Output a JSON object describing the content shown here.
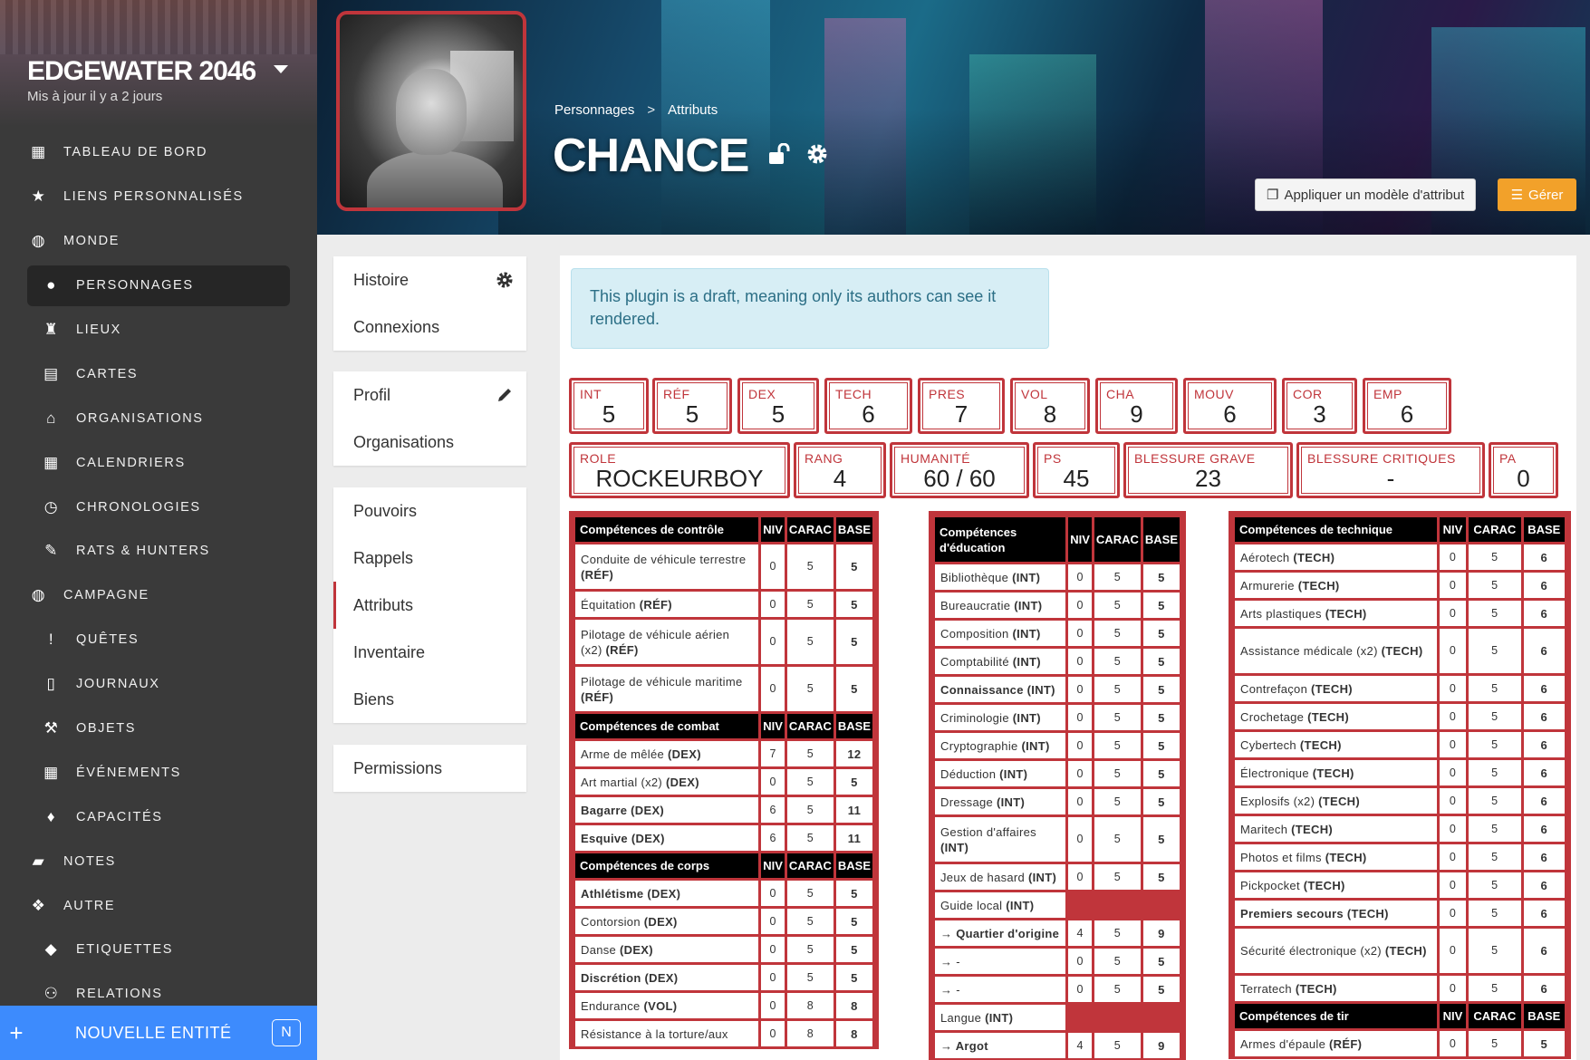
{
  "sidebar": {
    "campaign_name": "EDGEWATER 2046",
    "campaign_updated": "Mis à jour il y a 2 jours",
    "items": [
      {
        "label": "TABLEAU DE BORD",
        "icon": "dashboard-icon",
        "glyph": "▦",
        "level": 0
      },
      {
        "label": "LIENS PERSONNALISÉS",
        "icon": "star-icon",
        "glyph": "★",
        "level": 0
      },
      {
        "label": "MONDE",
        "icon": "globe-icon",
        "glyph": "◍",
        "level": 0
      },
      {
        "label": "PERSONNAGES",
        "icon": "user-icon",
        "glyph": "●",
        "level": 1,
        "active": true
      },
      {
        "label": "LIEUX",
        "icon": "chess-rook-icon",
        "glyph": "♜",
        "level": 1
      },
      {
        "label": "CARTES",
        "icon": "map-icon",
        "glyph": "▤",
        "level": 1
      },
      {
        "label": "ORGANISATIONS",
        "icon": "university-icon",
        "glyph": "⌂",
        "level": 1
      },
      {
        "label": "CALENDRIERS",
        "icon": "calendar-icon",
        "glyph": "▦",
        "level": 1
      },
      {
        "label": "CHRONOLOGIES",
        "icon": "clock-icon",
        "glyph": "◷",
        "level": 1
      },
      {
        "label": "RATS & HUNTERS",
        "icon": "feather-icon",
        "glyph": "✎",
        "level": 1
      },
      {
        "label": "CAMPAGNE",
        "icon": "globe-icon",
        "glyph": "◍",
        "level": 0
      },
      {
        "label": "QUÊTES",
        "icon": "exclamation-icon",
        "glyph": "!",
        "level": 1
      },
      {
        "label": "JOURNAUX",
        "icon": "file-icon",
        "glyph": "▯",
        "level": 1
      },
      {
        "label": "OBJETS",
        "icon": "objects-icon",
        "glyph": "⚒",
        "level": 1
      },
      {
        "label": "ÉVÉNEMENTS",
        "icon": "calendar-icon",
        "glyph": "▦",
        "level": 1
      },
      {
        "label": "CAPACITÉS",
        "icon": "fire-icon",
        "glyph": "♦",
        "level": 1
      },
      {
        "label": "NOTES",
        "icon": "sticky-note-icon",
        "glyph": "▰",
        "level": 0
      },
      {
        "label": "AUTRE",
        "icon": "cubes-icon",
        "glyph": "❖",
        "level": 0
      },
      {
        "label": "ETIQUETTES",
        "icon": "tags-icon",
        "glyph": "◆",
        "level": 1
      },
      {
        "label": "RELATIONS",
        "icon": "people-icon",
        "glyph": "⚇",
        "level": 1
      }
    ],
    "new_entity_label": "NOUVELLE ENTITÉ",
    "new_entity_shortcut": "N"
  },
  "header": {
    "breadcrumb": [
      "Personnages",
      "Attributs"
    ],
    "breadcrumb_sep": ">",
    "character_name": "CHANCE",
    "apply_template_label": "Appliquer un modèle d'attribut",
    "manage_label": "Gérer"
  },
  "menu": {
    "group1": [
      {
        "label": "Histoire",
        "action": "gear-icon"
      },
      {
        "label": "Connexions"
      }
    ],
    "group2": [
      {
        "label": "Profil",
        "action": "pencil-icon"
      },
      {
        "label": "Organisations"
      }
    ],
    "group3": [
      {
        "label": "Pouvoirs"
      },
      {
        "label": "Rappels"
      },
      {
        "label": "Attributs",
        "active": true
      },
      {
        "label": "Inventaire"
      },
      {
        "label": "Biens"
      }
    ],
    "group4": [
      {
        "label": "Permissions"
      }
    ]
  },
  "alert": "This plugin is a draft, meaning only its authors can see it rendered.",
  "stats_row1": [
    {
      "label": "INT",
      "value": "5"
    },
    {
      "label": "RÉF",
      "value": "5"
    },
    {
      "label": "DEX",
      "value": "5"
    },
    {
      "label": "TECH",
      "value": "6"
    },
    {
      "label": "PRES",
      "value": "7"
    },
    {
      "label": "VOL",
      "value": "8"
    },
    {
      "label": "CHA",
      "value": "9"
    },
    {
      "label": "MOUV",
      "value": "6"
    },
    {
      "label": "COR",
      "value": "3"
    },
    {
      "label": "EMP",
      "value": "6"
    }
  ],
  "stats_row2": [
    {
      "label": "ROLE",
      "value": "ROCKEURBOY"
    },
    {
      "label": "RANG",
      "value": "4"
    },
    {
      "label": "HUMANITÉ",
      "value": "60 / 60"
    },
    {
      "label": "PS",
      "value": "45"
    },
    {
      "label": "BLESSURE GRAVE",
      "value": "23"
    },
    {
      "label": "BLESSURE CRITIQUES",
      "value": "-"
    },
    {
      "label": "PA",
      "value": "0"
    }
  ],
  "columns_header": {
    "niv": "NIV",
    "carac": "CARAC",
    "base": "BASE"
  },
  "col1": [
    {
      "title": "Compétences de contrôle"
    },
    {
      "name": "Conduite de véhicule terrestre",
      "attr": "(RÉF)",
      "niv": "0",
      "carac": "5",
      "base": "5",
      "tall": true
    },
    {
      "name": "Équitation",
      "attr": "(RÉF)",
      "niv": "0",
      "carac": "5",
      "base": "5"
    },
    {
      "name": "Pilotage de véhicule aérien (x2)",
      "attr": "(RÉF)",
      "niv": "0",
      "carac": "5",
      "base": "5",
      "tall": true
    },
    {
      "name": "Pilotage de véhicule maritime",
      "attr": "(RÉF)",
      "niv": "0",
      "carac": "5",
      "base": "5",
      "tall": true
    },
    {
      "title": "Compétences de combat"
    },
    {
      "name": "Arme de mêlée",
      "attr": "(DEX)",
      "niv": "7",
      "carac": "5",
      "base": "12"
    },
    {
      "name": "Art martial (x2)",
      "attr": "(DEX)",
      "niv": "0",
      "carac": "5",
      "base": "5"
    },
    {
      "name": "Bagarre",
      "attr": "(DEX)",
      "niv": "6",
      "carac": "5",
      "base": "11",
      "bold": true
    },
    {
      "name": "Esquive",
      "attr": "(DEX)",
      "niv": "6",
      "carac": "5",
      "base": "11",
      "bold": true
    },
    {
      "title": "Compétences de corps"
    },
    {
      "name": "Athlétisme",
      "attr": "(DEX)",
      "niv": "0",
      "carac": "5",
      "base": "5",
      "bold": true
    },
    {
      "name": "Contorsion",
      "attr": "(DEX)",
      "niv": "0",
      "carac": "5",
      "base": "5"
    },
    {
      "name": "Danse",
      "attr": "(DEX)",
      "niv": "0",
      "carac": "5",
      "base": "5"
    },
    {
      "name": "Discrétion",
      "attr": "(DEX)",
      "niv": "0",
      "carac": "5",
      "base": "5",
      "bold": true
    },
    {
      "name": "Endurance",
      "attr": "(VOL)",
      "niv": "0",
      "carac": "8",
      "base": "8"
    },
    {
      "name": "Résistance à la torture/aux",
      "attr": "",
      "niv": "0",
      "carac": "8",
      "base": "8"
    }
  ],
  "col2": [
    {
      "title": "Compétences d'éducation",
      "tall": true
    },
    {
      "name": "Bibliothèque",
      "attr": "(INT)",
      "niv": "0",
      "carac": "5",
      "base": "5"
    },
    {
      "name": "Bureaucratie",
      "attr": "(INT)",
      "niv": "0",
      "carac": "5",
      "base": "5"
    },
    {
      "name": "Composition",
      "attr": "(INT)",
      "niv": "0",
      "carac": "5",
      "base": "5"
    },
    {
      "name": "Comptabilité",
      "attr": "(INT)",
      "niv": "0",
      "carac": "5",
      "base": "5"
    },
    {
      "name": "Connaissance",
      "attr": "(INT)",
      "niv": "0",
      "carac": "5",
      "base": "5",
      "bold": true
    },
    {
      "name": "Criminologie",
      "attr": "(INT)",
      "niv": "0",
      "carac": "5",
      "base": "5"
    },
    {
      "name": "Cryptographie",
      "attr": "(INT)",
      "niv": "0",
      "carac": "5",
      "base": "5"
    },
    {
      "name": "Déduction",
      "attr": "(INT)",
      "niv": "0",
      "carac": "5",
      "base": "5"
    },
    {
      "name": "Dressage",
      "attr": "(INT)",
      "niv": "0",
      "carac": "5",
      "base": "5"
    },
    {
      "name": "Gestion d'affaires",
      "attr": "(INT)",
      "niv": "0",
      "carac": "5",
      "base": "5",
      "tall": true
    },
    {
      "name": "Jeux de hasard",
      "attr": "(INT)",
      "niv": "0",
      "carac": "5",
      "base": "5"
    },
    {
      "name": "Guide local",
      "attr": "(INT)",
      "group": true
    },
    {
      "name": "→ Quartier d'origine",
      "attr": "",
      "niv": "4",
      "carac": "5",
      "base": "9",
      "bold": true
    },
    {
      "name": "→ -",
      "attr": "",
      "niv": "0",
      "carac": "5",
      "base": "5"
    },
    {
      "name": "→ -",
      "attr": "",
      "niv": "0",
      "carac": "5",
      "base": "5"
    },
    {
      "name": "Langue",
      "attr": "(INT)",
      "group": true
    },
    {
      "name": "→ Argot",
      "attr": "",
      "niv": "4",
      "carac": "5",
      "base": "9",
      "bold": true
    }
  ],
  "col3": [
    {
      "title": "Compétences de technique"
    },
    {
      "name": "Aérotech",
      "attr": "(TECH)",
      "niv": "0",
      "carac": "5",
      "base": "6"
    },
    {
      "name": "Armurerie",
      "attr": "(TECH)",
      "niv": "0",
      "carac": "5",
      "base": "6"
    },
    {
      "name": "Arts plastiques",
      "attr": "(TECH)",
      "niv": "0",
      "carac": "5",
      "base": "6"
    },
    {
      "name": "Assistance médicale (x2)",
      "attr": "(TECH)",
      "niv": "0",
      "carac": "5",
      "base": "6",
      "tall": true
    },
    {
      "name": "Contrefaçon",
      "attr": "(TECH)",
      "niv": "0",
      "carac": "5",
      "base": "6"
    },
    {
      "name": "Crochetage",
      "attr": "(TECH)",
      "niv": "0",
      "carac": "5",
      "base": "6"
    },
    {
      "name": "Cybertech",
      "attr": "(TECH)",
      "niv": "0",
      "carac": "5",
      "base": "6"
    },
    {
      "name": "Électronique",
      "attr": "(TECH)",
      "niv": "0",
      "carac": "5",
      "base": "6"
    },
    {
      "name": "Explosifs (x2)",
      "attr": "(TECH)",
      "niv": "0",
      "carac": "5",
      "base": "6"
    },
    {
      "name": "Maritech",
      "attr": "(TECH)",
      "niv": "0",
      "carac": "5",
      "base": "6"
    },
    {
      "name": "Photos et films",
      "attr": "(TECH)",
      "niv": "0",
      "carac": "5",
      "base": "6"
    },
    {
      "name": "Pickpocket",
      "attr": "(TECH)",
      "niv": "0",
      "carac": "5",
      "base": "6"
    },
    {
      "name": "Premiers secours",
      "attr": "(TECH)",
      "niv": "0",
      "carac": "5",
      "base": "6",
      "bold": true
    },
    {
      "name": "Sécurité électronique (x2)",
      "attr": "(TECH)",
      "niv": "0",
      "carac": "5",
      "base": "6",
      "tall": true
    },
    {
      "name": "Terratech",
      "attr": "(TECH)",
      "niv": "0",
      "carac": "5",
      "base": "6"
    },
    {
      "title": "Compétences de tir"
    },
    {
      "name": "Armes d'épaule",
      "attr": "(RÉF)",
      "niv": "0",
      "carac": "5",
      "base": "5"
    }
  ]
}
